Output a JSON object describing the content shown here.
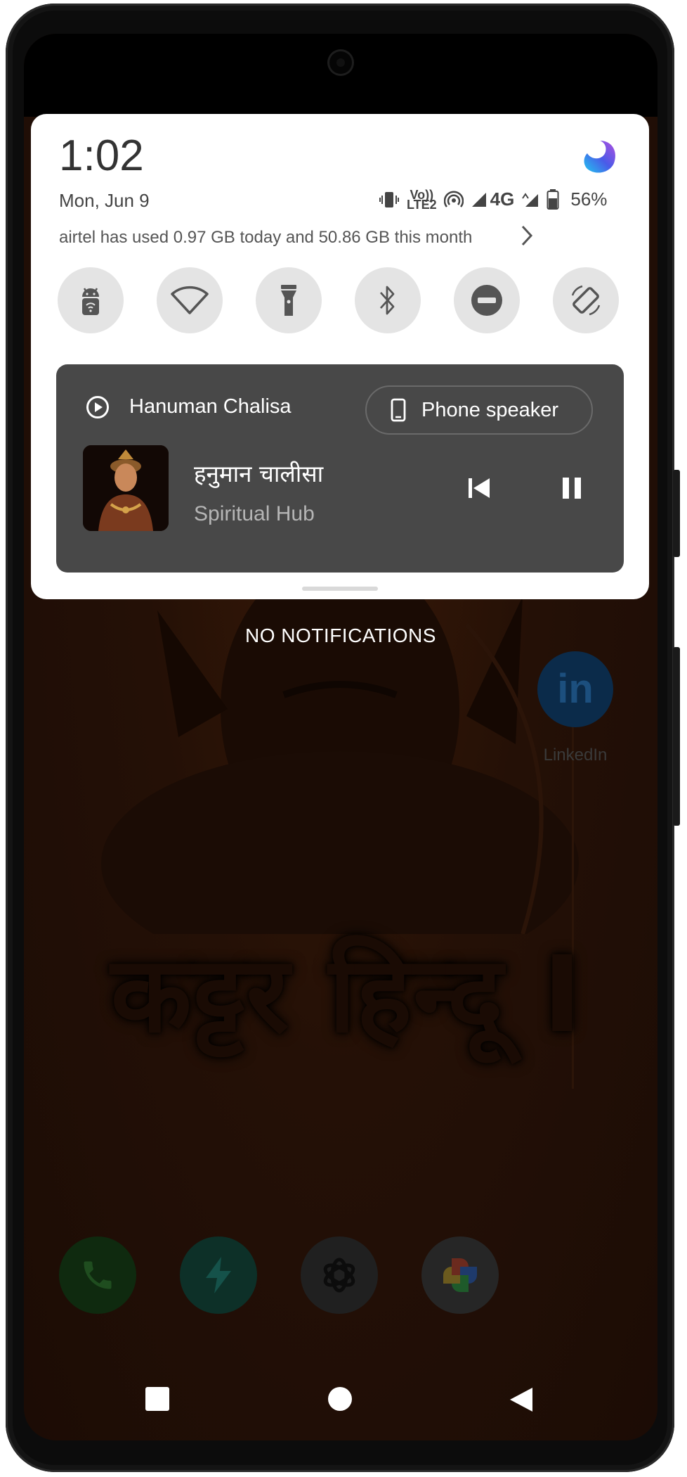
{
  "status": {
    "time": "1:02",
    "date": "Mon, Jun 9",
    "network_vo": "Vo))",
    "network_lte": "LTE2",
    "network_type": "4G",
    "battery": "56%"
  },
  "data_usage": {
    "text": "airtel has used 0.97 GB today and 50.86 GB this month"
  },
  "quick_settings": [
    {
      "name": "android-wifi-hotspot",
      "icon": "android-icon"
    },
    {
      "name": "wifi",
      "icon": "wifi-icon"
    },
    {
      "name": "flashlight",
      "icon": "flashlight-icon"
    },
    {
      "name": "bluetooth",
      "icon": "bluetooth-icon"
    },
    {
      "name": "do-not-disturb",
      "icon": "dnd-icon"
    },
    {
      "name": "auto-rotate",
      "icon": "rotate-icon"
    }
  ],
  "media": {
    "app_name": "Hanuman Chalisa",
    "output_device": "Phone speaker",
    "track_title": "हनुमान चालीसा",
    "track_artist": "Spiritual Hub"
  },
  "notifications": {
    "empty_label": "NO NOTIFICATIONS"
  },
  "home": {
    "wallpaper_text": "कट्टर हिन्दू I",
    "linkedin_label": "LinkedIn",
    "linkedin_logo": "in",
    "dock_apps": [
      "phone-icon",
      "bolt-icon",
      "chatgpt-icon",
      "photos-icon"
    ]
  },
  "colors": {
    "media_card_bg": "#484848",
    "qs_tile_bg": "#e4e4e4",
    "wallpaper_bg": "#241006"
  }
}
